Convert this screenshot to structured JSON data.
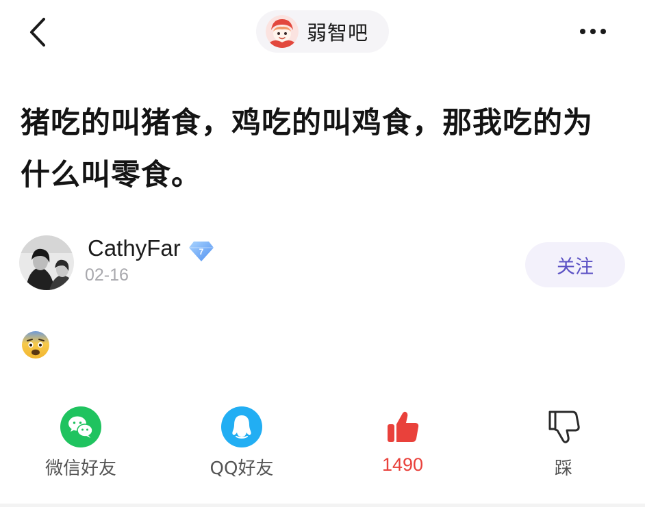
{
  "header": {
    "forum_name": "弱智吧"
  },
  "post": {
    "title": "猪吃的叫猪食，鸡吃的叫鸡食，那我吃的为什么叫零食。",
    "author": {
      "name": "CathyFar",
      "level": "7",
      "date": "02-16"
    },
    "follow_label": "关注",
    "body_emoji": "fearful-face-emoji"
  },
  "actions": {
    "wechat_label": "微信好友",
    "qq_label": "QQ好友",
    "like_count": "1490",
    "dislike_label": "踩"
  },
  "colors": {
    "accent": "#5b51c4",
    "like": "#e9413b",
    "wechat": "#1fc35f",
    "qq": "#22aef3"
  }
}
